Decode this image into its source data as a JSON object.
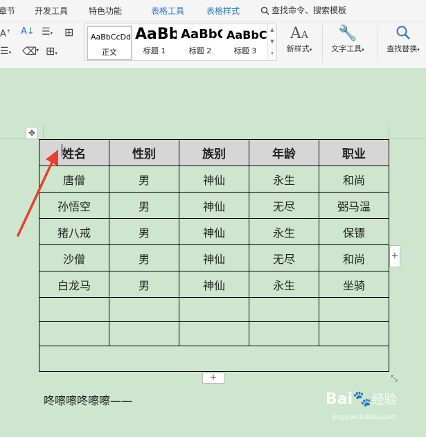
{
  "ribbon": {
    "tabs": [
      {
        "label": "章节"
      },
      {
        "label": "开发工具"
      },
      {
        "label": "特色功能"
      },
      {
        "label": "表格工具"
      },
      {
        "label": "表格样式"
      }
    ],
    "search_label": "查找命令、搜索模板",
    "styles": [
      {
        "sample": "AaBbCcDd",
        "caption": "正文"
      },
      {
        "sample": "AaBb",
        "caption": "标题 1"
      },
      {
        "sample": "AaBbC",
        "caption": "标题 2"
      },
      {
        "sample": "AaBbC",
        "caption": "标题 3"
      }
    ],
    "new_style_label": "新样式",
    "text_tools_label": "文字工具",
    "find_replace_label": "查找替换"
  },
  "table": {
    "headers": [
      "姓名",
      "性别",
      "族别",
      "年龄",
      "职业"
    ],
    "rows": [
      [
        "唐僧",
        "男",
        "神仙",
        "永生",
        "和尚"
      ],
      [
        "孙悟空",
        "男",
        "神仙",
        "无尽",
        "弼马温"
      ],
      [
        "猪八戒",
        "男",
        "神仙",
        "永生",
        "保镖"
      ],
      [
        "沙僧",
        "男",
        "神仙",
        "无尽",
        "和尚"
      ],
      [
        "白龙马",
        "男",
        "神仙",
        "永生",
        "坐骑"
      ],
      [
        "",
        "",
        "",
        "",
        ""
      ],
      [
        "",
        "",
        "",
        "",
        ""
      ]
    ]
  },
  "paragraph": "咚嚓嚓咚嚓嚓——",
  "watermark": {
    "brand": "Bai",
    "brand2": "经验",
    "url": "jingyan.baidu.com"
  },
  "colors": {
    "accent": "#2a78d4",
    "page": "#cde6cd",
    "arrow": "#e8402f",
    "header_fill": "#d6d6d6"
  }
}
